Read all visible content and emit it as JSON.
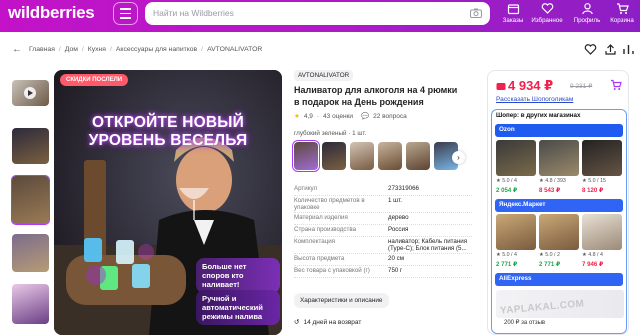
{
  "header": {
    "logo": "wildberries",
    "search_placeholder": "Найти на Wildberries",
    "nav": [
      {
        "label": "Заказы"
      },
      {
        "label": "Избранное"
      },
      {
        "label": "Профиль"
      },
      {
        "label": "Корзина"
      }
    ]
  },
  "breadcrumbs": [
    "Главная",
    "Дом",
    "Кухня",
    "Аксессуары для напитков",
    "AVTONALIVATOR"
  ],
  "gallery": {
    "badge": "СКИДКИ ПОСЛЕЛИ",
    "headline_1": "ОТКРОЙТЕ НОВЫЙ",
    "headline_2": "УРОВЕНЬ ВЕСЕЛЬЯ",
    "bubble_1": "Больше нет споров кто наливает!",
    "bubble_2": "Ручной и автоматический режимы налива"
  },
  "product": {
    "brand": "AVTONALIVATOR",
    "title": "Наливатор для алкоголя на 4 рюмки в подарок на День рождения",
    "rating": "4,9",
    "reviews": "43 оценки",
    "questions": "22 вопроса",
    "color_label": "глубокий зеленый · 1 шт.",
    "specs": [
      {
        "k": "Артикул",
        "v": "273319066"
      },
      {
        "k": "Количество предметов в упаковке",
        "v": "1 шт."
      },
      {
        "k": "Материал изделия",
        "v": "дерево"
      },
      {
        "k": "Страна производства",
        "v": "Россия"
      },
      {
        "k": "Комплектация",
        "v": "наливатор; Кабель питания (Type-C); Блок питания (5..."
      },
      {
        "k": "Высота предмета",
        "v": "20 см"
      },
      {
        "k": "Вес товара с упаковкой (г)",
        "v": "750 г"
      }
    ],
    "characteristics_button": "Характеристики и описание",
    "return": "14 дней на возврат"
  },
  "buy": {
    "price": "4 934 ₽",
    "old_price": "9 231 ₽",
    "split": "Рассказать Шопоголикам",
    "compare_title": "Шопер: в других магазинах",
    "shops": [
      {
        "name": "Ozon",
        "color": "#1f5bf0",
        "items": [
          {
            "rating": "★ 5.0 / 4",
            "price": "2 054 ₽"
          },
          {
            "rating": "★ 4.8 / 393",
            "price": "8 543 ₽"
          },
          {
            "rating": "★ 5.0 / 15",
            "price": "8 120 ₽"
          }
        ]
      },
      {
        "name": "Яндекс.Маркет",
        "color": "#2f64f5",
        "items": [
          {
            "rating": "★ 5.0 / 4",
            "price": "2 771 ₽"
          },
          {
            "rating": "★ 5.0 / 2",
            "price": "2 771 ₽"
          },
          {
            "rating": "★ 4.8 / 4",
            "price": "7 946 ₽"
          }
        ]
      },
      {
        "name": "AliExpress",
        "color": "#2f64f5",
        "items": []
      }
    ],
    "footer": "200 ₽ за отзыв"
  },
  "watermark": "YAPLAKAL.COM",
  "colors": {
    "brand": "#b21ac6",
    "price": "#f0224d",
    "accent": "#a73afd"
  }
}
